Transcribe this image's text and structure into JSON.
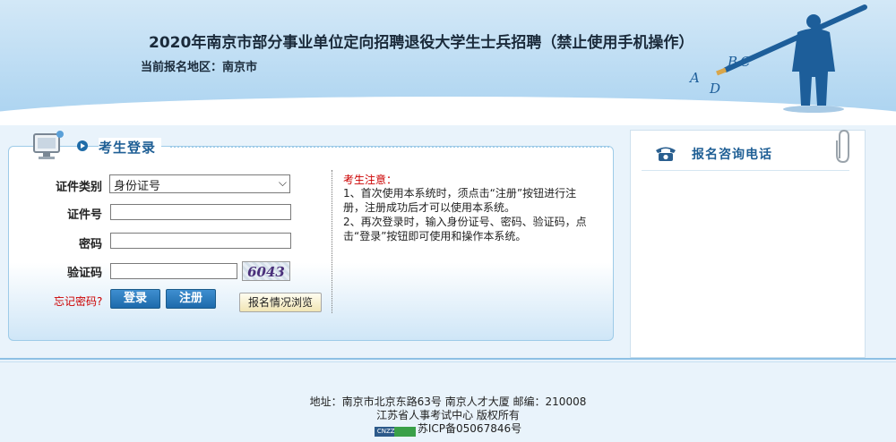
{
  "header": {
    "title": "2020年南京市部分事业单位定向招聘退役大学生士兵招聘（禁止使用手机操作）",
    "region_label": "当前报名地区：南京市",
    "mascot_letters": [
      "A",
      "B",
      "C",
      "D"
    ]
  },
  "login": {
    "title": "考生登录",
    "id_type_label": "证件类别",
    "id_type_value": "身份证号",
    "id_number_label": "证件号",
    "password_label": "密码",
    "captcha_label": "验证码",
    "captcha_code": "6043",
    "forgot_password": "忘记密码?",
    "login_button": "登录",
    "register_button": "注册",
    "browse_button": "报名情况浏览"
  },
  "notice": {
    "title": "考生注意：",
    "item1": "1、首次使用本系统时，须点击“注册”按钮进行注册，注册成功后才可以使用本系统。",
    "item2": "2、再次登录时，输入身份证号、密码、验证码，点击“登录”按钮即可使用和操作本系统。"
  },
  "consult": {
    "title": "报名咨询电话"
  },
  "footer": {
    "address": "地址：南京市北京东路63号 南京人才大厦 邮编：210008",
    "copyright": "江苏省人事考试中心 版权所有",
    "badge_text": "CNZZ",
    "icp": "苏ICP备05067846号"
  }
}
